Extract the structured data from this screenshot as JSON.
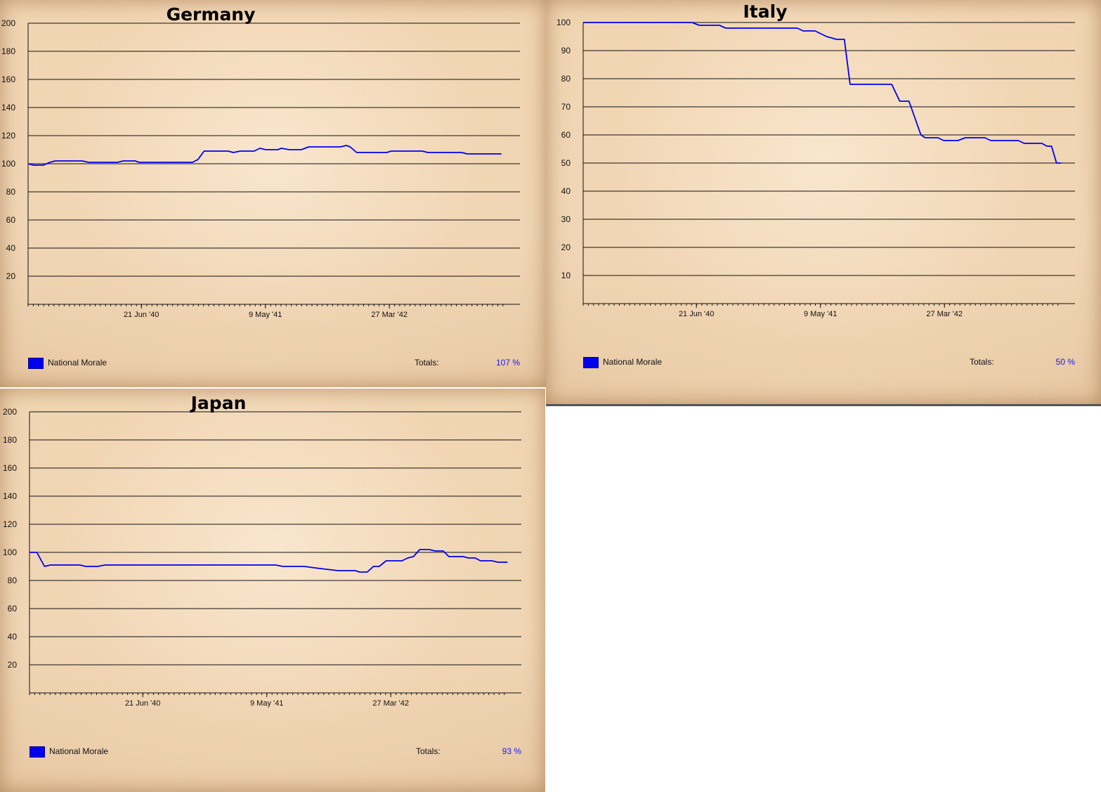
{
  "legend_label": "National Morale",
  "totals_label": "Totals:",
  "series_color": "#0000ee",
  "chart_data": [
    {
      "type": "line",
      "title": "Germany",
      "ylim": [
        0,
        200
      ],
      "yticks": [
        20,
        40,
        60,
        80,
        100,
        120,
        140,
        160,
        180,
        200
      ],
      "xlim": [
        "1939-09-01",
        "1943-03-01"
      ],
      "xticks": [
        {
          "label": "21 Jun '40",
          "date": "1940-06-21"
        },
        {
          "label": "9 May '41",
          "date": "1941-05-09"
        },
        {
          "label": "27 Mar '42",
          "date": "1942-03-27"
        }
      ],
      "grid": true,
      "legend": "bottom-left",
      "total": "107 %",
      "series": [
        {
          "name": "National Morale",
          "points": [
            [
              "1939-09-01",
              100
            ],
            [
              "1939-09-15",
              99
            ],
            [
              "1939-10-10",
              99
            ],
            [
              "1939-10-28",
              101
            ],
            [
              "1939-11-10",
              102
            ],
            [
              "1940-01-20",
              102
            ],
            [
              "1940-02-05",
              101
            ],
            [
              "1940-04-20",
              101
            ],
            [
              "1940-05-05",
              102
            ],
            [
              "1940-06-05",
              102
            ],
            [
              "1940-06-15",
              101
            ],
            [
              "1940-11-01",
              101
            ],
            [
              "1940-11-15",
              103
            ],
            [
              "1940-12-01",
              109
            ],
            [
              "1941-02-01",
              109
            ],
            [
              "1941-02-15",
              108
            ],
            [
              "1941-03-05",
              109
            ],
            [
              "1941-04-10",
              109
            ],
            [
              "1941-04-25",
              111
            ],
            [
              "1941-05-10",
              110
            ],
            [
              "1941-06-10",
              110
            ],
            [
              "1941-06-20",
              111
            ],
            [
              "1941-07-10",
              110
            ],
            [
              "1941-08-10",
              110
            ],
            [
              "1941-08-30",
              112
            ],
            [
              "1941-11-20",
              112
            ],
            [
              "1941-12-05",
              113
            ],
            [
              "1941-12-15",
              112
            ],
            [
              "1942-01-01",
              108
            ],
            [
              "1942-03-20",
              108
            ],
            [
              "1942-04-01",
              109
            ],
            [
              "1942-06-20",
              109
            ],
            [
              "1942-07-05",
              108
            ],
            [
              "1942-10-01",
              108
            ],
            [
              "1942-10-15",
              107
            ],
            [
              "1943-01-12",
              107
            ]
          ]
        }
      ]
    },
    {
      "type": "line",
      "title": "Italy",
      "ylim": [
        0,
        100
      ],
      "yticks": [
        10,
        20,
        30,
        40,
        50,
        60,
        70,
        80,
        90,
        100
      ],
      "xlim": [
        "1939-09-01",
        "1943-03-01"
      ],
      "xticks": [
        {
          "label": "21 Jun '40",
          "date": "1940-06-21"
        },
        {
          "label": "9 May '41",
          "date": "1941-05-09"
        },
        {
          "label": "27 Mar '42",
          "date": "1942-03-27"
        }
      ],
      "grid": true,
      "legend": "bottom-left",
      "total": "50 %",
      "series": [
        {
          "name": "National Morale",
          "points": [
            [
              "1939-09-01",
              100
            ],
            [
              "1940-06-10",
              100
            ],
            [
              "1940-06-28",
              99
            ],
            [
              "1940-08-20",
              99
            ],
            [
              "1940-09-05",
              98
            ],
            [
              "1941-03-10",
              98
            ],
            [
              "1941-03-25",
              97
            ],
            [
              "1941-04-25",
              97
            ],
            [
              "1941-05-10",
              96
            ],
            [
              "1941-05-25",
              95
            ],
            [
              "1941-06-20",
              94
            ],
            [
              "1941-07-10",
              94
            ],
            [
              "1941-07-25",
              78
            ],
            [
              "1941-11-10",
              78
            ],
            [
              "1941-12-01",
              72
            ],
            [
              "1941-12-25",
              72
            ],
            [
              "1942-01-25",
              60
            ],
            [
              "1942-02-05",
              59
            ],
            [
              "1942-03-10",
              59
            ],
            [
              "1942-03-25",
              58
            ],
            [
              "1942-05-01",
              58
            ],
            [
              "1942-05-20",
              59
            ],
            [
              "1942-07-10",
              59
            ],
            [
              "1942-07-25",
              58
            ],
            [
              "1942-10-05",
              58
            ],
            [
              "1942-10-20",
              57
            ],
            [
              "1942-12-05",
              57
            ],
            [
              "1942-12-18",
              56
            ],
            [
              "1942-12-30",
              56
            ],
            [
              "1943-01-12",
              50
            ],
            [
              "1943-01-24",
              50
            ]
          ]
        }
      ]
    },
    {
      "type": "line",
      "title": "Japan",
      "ylim": [
        0,
        200
      ],
      "yticks": [
        20,
        40,
        60,
        80,
        100,
        120,
        140,
        160,
        180,
        200
      ],
      "xlim": [
        "1939-09-01",
        "1943-03-01"
      ],
      "xticks": [
        {
          "label": "21 Jun '40",
          "date": "1940-06-21"
        },
        {
          "label": "9 May '41",
          "date": "1941-05-09"
        },
        {
          "label": "27 Mar '42",
          "date": "1942-03-27"
        }
      ],
      "grid": true,
      "legend": "bottom-left",
      "total": "93 %",
      "series": [
        {
          "name": "National Morale",
          "points": [
            [
              "1939-09-01",
              100
            ],
            [
              "1939-09-20",
              100
            ],
            [
              "1939-10-10",
              90
            ],
            [
              "1939-10-25",
              91
            ],
            [
              "1940-01-10",
              91
            ],
            [
              "1940-01-25",
              90
            ],
            [
              "1940-02-25",
              90
            ],
            [
              "1940-03-15",
              91
            ],
            [
              "1941-06-01",
              91
            ],
            [
              "1941-06-20",
              90
            ],
            [
              "1941-08-15",
              90
            ],
            [
              "1941-09-10",
              89
            ],
            [
              "1941-10-10",
              88
            ],
            [
              "1941-11-10",
              87
            ],
            [
              "1941-12-25",
              87
            ],
            [
              "1942-01-05",
              86
            ],
            [
              "1942-01-25",
              86
            ],
            [
              "1942-02-10",
              90
            ],
            [
              "1942-02-25",
              90
            ],
            [
              "1942-03-15",
              94
            ],
            [
              "1942-04-25",
              94
            ],
            [
              "1942-05-10",
              96
            ],
            [
              "1942-05-25",
              97
            ],
            [
              "1942-06-10",
              102
            ],
            [
              "1942-07-05",
              102
            ],
            [
              "1942-07-20",
              101
            ],
            [
              "1942-08-10",
              101
            ],
            [
              "1942-08-25",
              97
            ],
            [
              "1942-10-01",
              97
            ],
            [
              "1942-10-15",
              96
            ],
            [
              "1942-11-01",
              96
            ],
            [
              "1942-11-15",
              94
            ],
            [
              "1942-12-15",
              94
            ],
            [
              "1942-12-30",
              93
            ],
            [
              "1943-01-24",
              93
            ]
          ]
        }
      ]
    }
  ]
}
